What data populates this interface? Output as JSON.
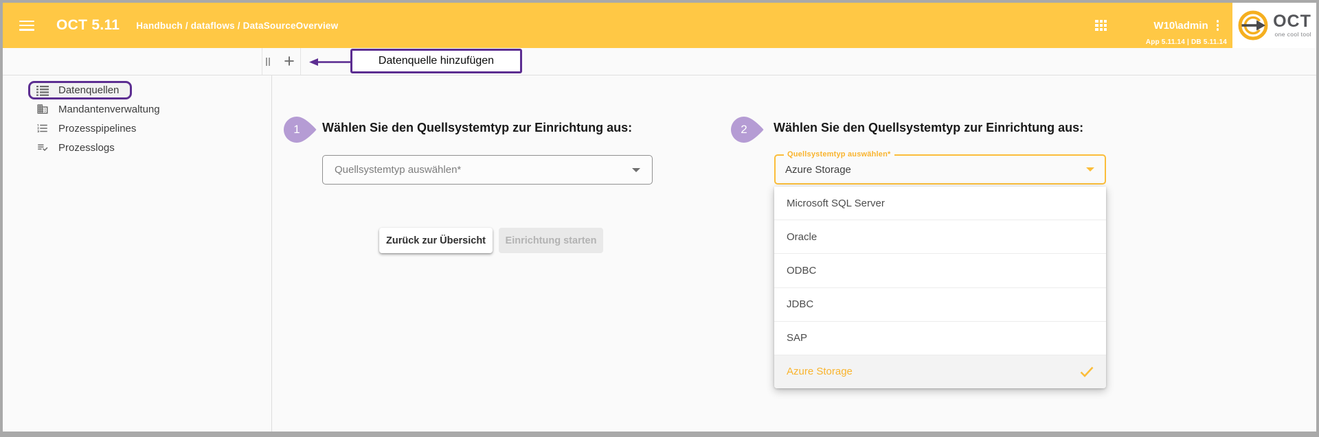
{
  "colors": {
    "header_amber": "#ffc845",
    "accent_amber": "#fbbd3a",
    "amber_text": "#f9b42e",
    "annotation_purple": "#5c2d91",
    "badge_purple": "#b59cd4",
    "background": "#fafafa",
    "frame_gray": "#a9a9a9"
  },
  "header": {
    "app_title": "OCT 5.11",
    "breadcrumb": "Handbuch / dataflows / DataSourceOverview",
    "user": "W10\\admin",
    "version": "App 5.11.14 | DB 5.11.14",
    "logo_text": "OCT",
    "logo_tagline": "one cool tool"
  },
  "toolbar": {
    "add_label": "+",
    "annotation_label": "Datenquelle hinzufügen"
  },
  "sidebar": {
    "items": [
      {
        "label": "Datenquellen",
        "icon": "list-icon",
        "highlighted": true
      },
      {
        "label": "Mandantenverwaltung",
        "icon": "building-icon",
        "highlighted": false
      },
      {
        "label": "Prozesspipelines",
        "icon": "numbered-list-icon",
        "highlighted": false
      },
      {
        "label": "Prozesslogs",
        "icon": "checklist-icon",
        "highlighted": false
      }
    ]
  },
  "steps": [
    {
      "number": "1",
      "title": "Wählen Sie den Quellsystemtyp zur Einrichtung aus:",
      "select_placeholder": "Quellsystemtyp auswählen*",
      "back_button": "Zurück zur Übersicht",
      "start_button": "Einrichtung starten"
    },
    {
      "number": "2",
      "title": "Wählen Sie den Quellsystemtyp zur Einrichtung aus:",
      "select_label": "Quellsystemtyp auswählen*",
      "select_value": "Azure Storage",
      "options": [
        "Microsoft SQL Server",
        "Oracle",
        "ODBC",
        "JDBC",
        "SAP",
        "Azure Storage"
      ],
      "selected_option": "Azure Storage"
    }
  ]
}
